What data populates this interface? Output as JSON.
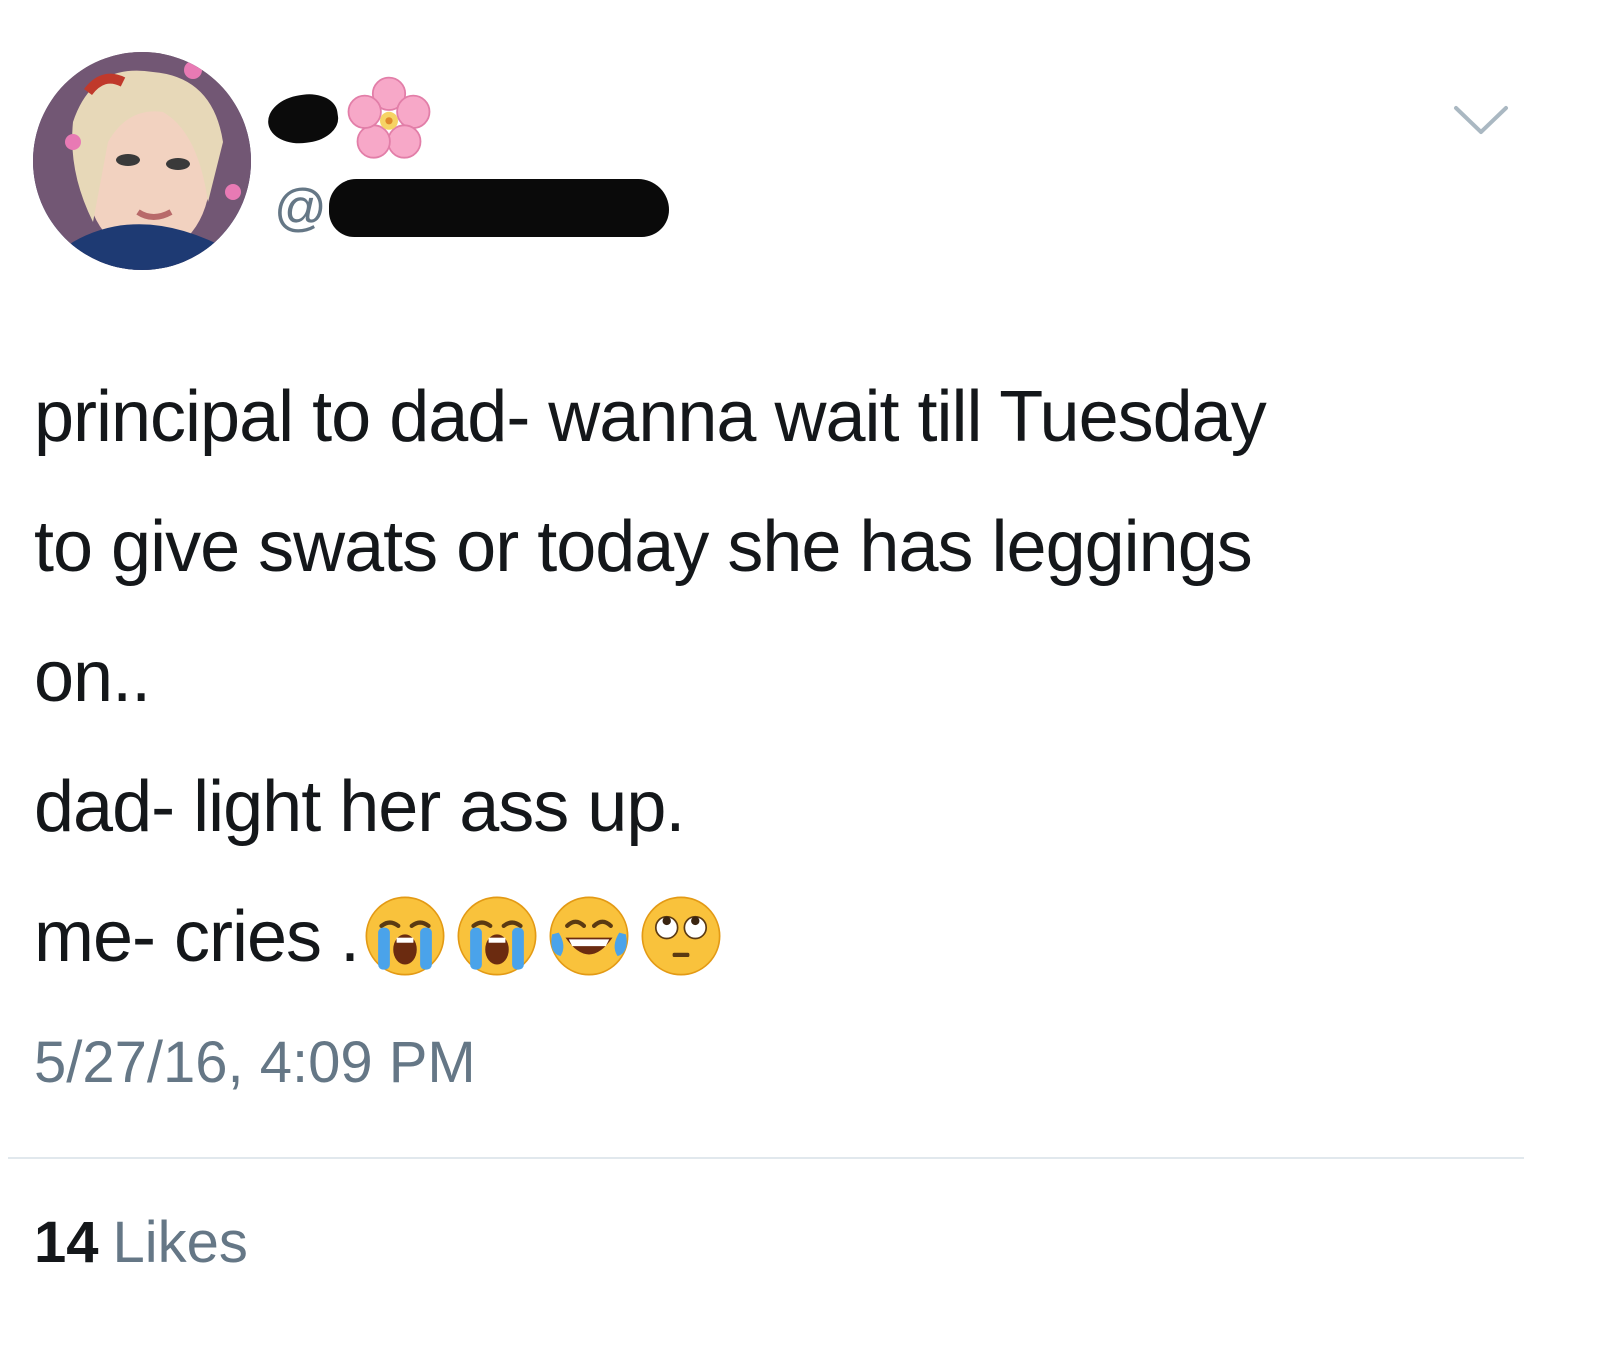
{
  "tweet": {
    "author": {
      "handle_prefix": "@",
      "display_name_icon": "cherry-blossom-icon",
      "avatar_icon": "profile-photo"
    },
    "menu_icon": "chevron-down-icon",
    "text_lines": [
      "principal to dad- wanna wait till Tuesday",
      "to give swats or today she has leggings",
      "on..",
      "dad- light her ass up.",
      "me- cries ."
    ],
    "emojis": [
      "loudly-crying-face",
      "loudly-crying-face",
      "face-with-tears-of-joy",
      "face-with-rolling-eyes"
    ],
    "timestamp": "5/27/16, 4:09 PM",
    "likes": {
      "count": "14",
      "label": "Likes"
    }
  },
  "colors": {
    "text": "#14171a",
    "secondary": "#657786",
    "divider": "#e1e8ed",
    "redaction": "#0a0a0a"
  }
}
